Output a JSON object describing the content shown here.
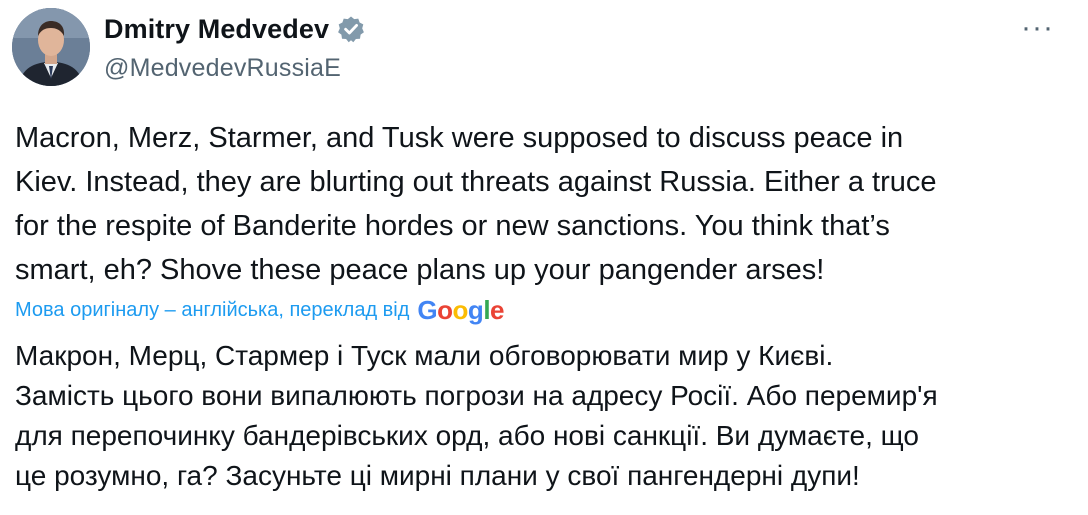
{
  "author": {
    "display_name": "Dmitry Medvedev",
    "handle": "@MedvedevRussiaE",
    "verified_icon": "verified-badge-icon",
    "verified_color": "#829aab"
  },
  "more_menu": "···",
  "tweet": {
    "lines": [
      "Macron, Merz, Starmer, and Tusk were supposed to discuss peace in",
      "Kiev. Instead, they are blurting out threats against Russia. Either a truce",
      "for the respite of Banderite hordes or new sanctions. You think that’s",
      "smart, eh? Shove these peace plans up your pangender arses!"
    ]
  },
  "translation": {
    "label": "Мова оригіналу – англійська, переклад від",
    "provider_letters": [
      "G",
      "o",
      "o",
      "g",
      "l",
      "e"
    ],
    "label_color": "#1d9bf0",
    "lines": [
      "Макрон, Мерц, Стармер і Туск мали обговорювати мир у Києві.",
      "Замість цього вони випалюють погрози на адресу Росії. Або перемир'я",
      "для перепочинку бандерівських орд, або нові санкції. Ви думаєте, що",
      "це розумно, га? Засуньте ці мирні плани у свої пангендерні дупи!"
    ]
  }
}
